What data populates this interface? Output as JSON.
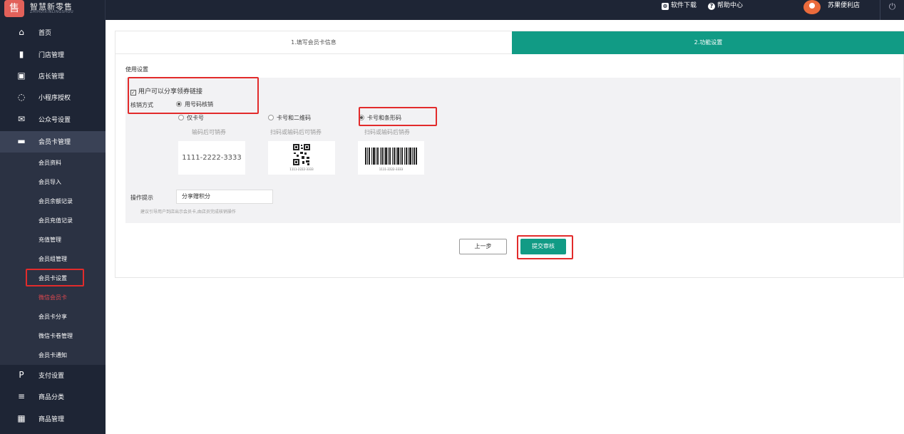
{
  "header": {
    "logo_mark": "售",
    "app_name": "智慧新零售",
    "app_sub": "ZHIHUIXINLINGSHOU",
    "download_label": "软件下载",
    "help_label": "帮助中心",
    "store_name": "苏果便利店",
    "download_icon_glyph": "⊜",
    "help_icon_glyph": "?",
    "power_glyph": "⏻"
  },
  "sidebar": {
    "items": [
      {
        "label": "首页",
        "icon": "home-icon",
        "glyph": "⌂"
      },
      {
        "label": "门店管理",
        "icon": "store-icon",
        "glyph": "▮"
      },
      {
        "label": "店长管理",
        "icon": "manager-icon",
        "glyph": "▣"
      },
      {
        "label": "小程序授权",
        "icon": "miniapp-icon",
        "glyph": "◌"
      },
      {
        "label": "公众号设置",
        "icon": "wechat-icon",
        "glyph": "✉"
      },
      {
        "label": "会员卡管理",
        "icon": "card-icon",
        "glyph": "▬"
      },
      {
        "label": "支付设置",
        "icon": "pay-icon",
        "glyph": "P"
      },
      {
        "label": "商品分类",
        "icon": "list-icon",
        "glyph": "≡"
      },
      {
        "label": "商品管理",
        "icon": "grid-icon",
        "glyph": "▦"
      }
    ],
    "sub_items": [
      "会员资料",
      "会员导入",
      "会员余额记录",
      "会员充值记录",
      "充值管理",
      "会员组管理",
      "会员卡设置",
      "微信会员卡",
      "会员卡分享",
      "微信卡卷管理",
      "会员卡通知"
    ]
  },
  "steps": {
    "step1": "1.填写会员卡信息",
    "step2": "2.功能设置"
  },
  "usage": {
    "section_title": "使用设置",
    "share_checkbox_label": "用户可以分享领券链接",
    "share_checked": true,
    "verify_label": "核销方式",
    "verify_options": [
      "用号码核销"
    ],
    "code_options": [
      {
        "label": "仅卡号",
        "note": "输码后可销券",
        "preview": "1111-2222-3333"
      },
      {
        "label": "卡号和二维码",
        "note": "扫码或输码后可销券",
        "preview": "1111-2222-3333"
      },
      {
        "label": "卡号和条形码",
        "note": "扫码或输码后销券",
        "preview": "1111-2222-3333"
      }
    ],
    "selected_code_option": "卡号和条形码",
    "op_label": "操作提示",
    "op_value": "分享赠积分",
    "op_hint": "建议引导用户到店出示会员卡,由店员完成核销操作"
  },
  "buttons": {
    "prev": "上一步",
    "submit": "提交审核"
  }
}
